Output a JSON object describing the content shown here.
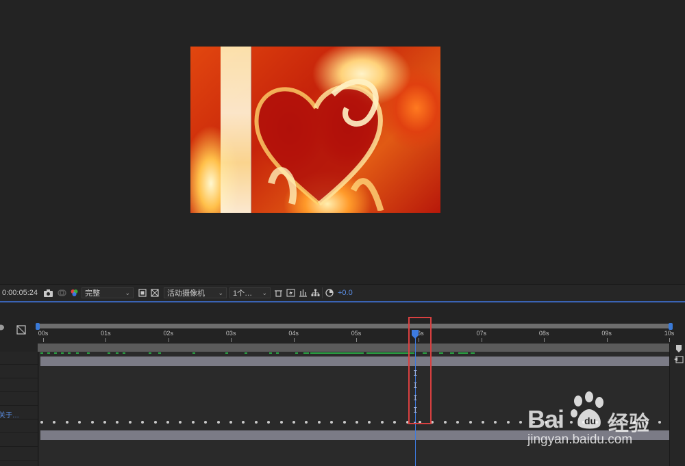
{
  "viewer": {
    "preview_description": "flaming heart composition frame"
  },
  "toolbar": {
    "timecode": "0:00:05:24",
    "resolution": "完整",
    "camera": "活动摄像机",
    "views": "1个…",
    "exposure": "+0.0"
  },
  "timeline": {
    "ruler_labels": [
      "00s",
      "01s",
      "02s",
      "03s",
      "04s",
      "05s",
      "06s",
      "07s",
      "08s",
      "09s",
      "10s"
    ],
    "playhead_label": "06s",
    "layer_label": "关于…"
  },
  "watermark": {
    "brand": "Bai",
    "brand_cn": "经验",
    "url": "jingyan.baidu.com"
  },
  "colors": {
    "accent": "#3d7be0",
    "highlight": "#d94040",
    "keyframe_green": "#2aa645"
  }
}
